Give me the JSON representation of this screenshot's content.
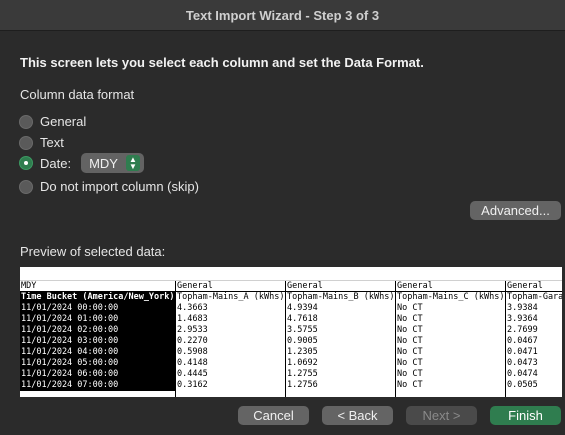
{
  "window": {
    "title": "Text Import Wizard - Step 3 of 3"
  },
  "intro": "This screen lets you select each column and set the Data Format.",
  "column_format": {
    "label": "Column data format",
    "options": [
      {
        "label": "General",
        "selected": false
      },
      {
        "label": "Text",
        "selected": false
      },
      {
        "label": "Date:",
        "selected": true
      },
      {
        "label": "Do not import column (skip)",
        "selected": false
      }
    ],
    "date_format": "MDY"
  },
  "advanced_button": "Advanced...",
  "preview": {
    "label": "Preview of selected data:",
    "columns": [
      {
        "format": "MDY",
        "cells": [
          "Time Bucket (America/New_York)",
          "11/01/2024 00:00:00",
          "11/01/2024 01:00:00",
          "11/01/2024 02:00:00",
          "11/01/2024 03:00:00",
          "11/01/2024 04:00:00",
          "11/01/2024 05:00:00",
          "11/01/2024 06:00:00",
          "11/01/2024 07:00:00"
        ]
      },
      {
        "format": "General",
        "cells": [
          "Topham-Mains_A (kWhs)",
          "4.3663",
          "1.4683",
          "2.9533",
          "0.2270",
          "0.5908",
          "0.4148",
          "0.4445",
          "0.3162"
        ]
      },
      {
        "format": "General",
        "cells": [
          "Topham-Mains_B (kWhs)",
          "4.9394",
          "4.7618",
          "3.5755",
          "0.9005",
          "1.2305",
          "1.0692",
          "1.2755",
          "1.2756"
        ]
      },
      {
        "format": "General",
        "cells": [
          "Topham-Mains_C (kWhs)",
          "No CT",
          "No CT",
          "No CT",
          "No CT",
          "No CT",
          "No CT",
          "No CT",
          "No CT"
        ]
      },
      {
        "format": "General",
        "cells": [
          "Topham-Garage",
          "3.9384",
          "3.9364",
          "2.7699",
          "0.0467",
          "0.0471",
          "0.0473",
          "0.0474",
          "0.0505"
        ]
      }
    ]
  },
  "buttons": {
    "cancel": "Cancel",
    "back": "< Back",
    "next": "Next >",
    "finish": "Finish"
  }
}
